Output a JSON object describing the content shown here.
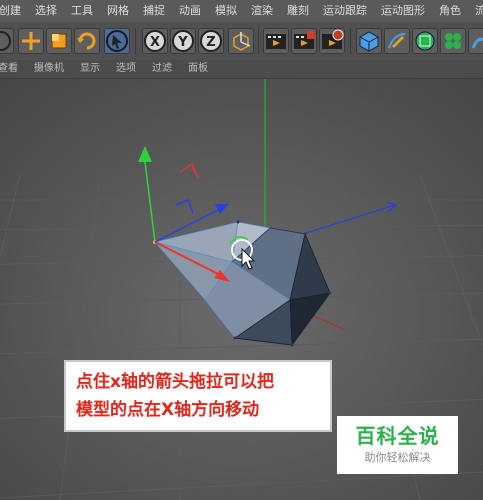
{
  "menu": [
    "创建",
    "选择",
    "工具",
    "网格",
    "捕捉",
    "动画",
    "模拟",
    "渲染",
    "雕刻",
    "运动跟踪",
    "运动图形",
    "角色",
    "流"
  ],
  "toolbar": {
    "axis_x": "X",
    "axis_y": "Y",
    "axis_z": "Z",
    "icons": [
      "undo-icon",
      "move-icon",
      "scale-icon",
      "rotate-icon",
      "select-icon",
      "x-axis-lock",
      "y-axis-lock",
      "z-axis-lock",
      "coordinate-system-icon",
      "render-view-icon",
      "render-picture-viewer-icon",
      "render-settings-icon",
      "cube-icon",
      "pen-icon",
      "subdivision-icon",
      "cloner-icon",
      "deformer-icon"
    ]
  },
  "view_menu": [
    "查看",
    "摄像机",
    "显示",
    "选项",
    "过滤",
    "面板"
  ],
  "caption": {
    "line1": "点住x轴的箭头拖拉可以把",
    "line2": "模型的点在X轴方向移动"
  },
  "watermark": {
    "title": "百科全说",
    "subtitle": "助你轻松解决"
  },
  "colors": {
    "x_axis": "#e8342a",
    "y_axis": "#2fd23c",
    "z_axis": "#2a3fe0",
    "caption_text": "#e4251b",
    "watermark_green": "#2db04b"
  }
}
